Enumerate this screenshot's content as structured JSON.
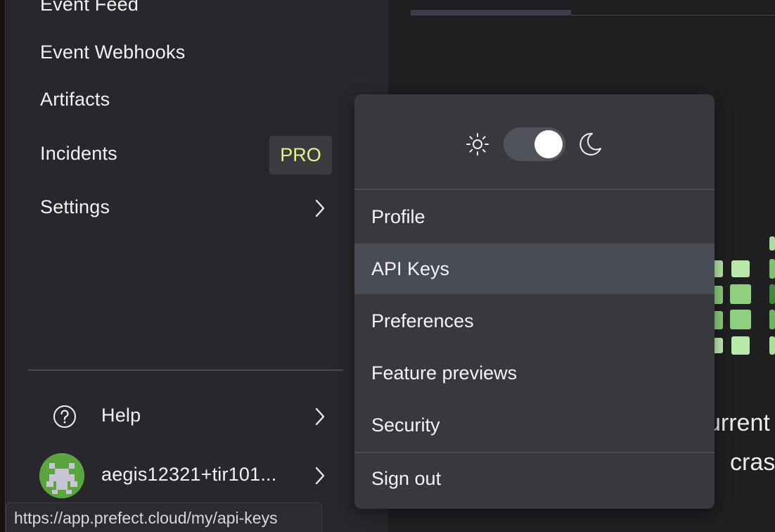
{
  "sidebar": {
    "items": [
      {
        "label": "Event Feed"
      },
      {
        "label": "Event Webhooks"
      },
      {
        "label": "Artifacts"
      },
      {
        "label": "Incidents",
        "badge": "PRO"
      },
      {
        "label": "Settings"
      }
    ],
    "help_label": "Help",
    "account_label": "aegis12321+tir101..."
  },
  "status_url": "https://app.prefect.cloud/my/api-keys",
  "user_menu": {
    "items": [
      "Profile",
      "API Keys",
      "Preferences",
      "Feature previews",
      "Security"
    ],
    "active_item": "API Keys",
    "sign_out": "Sign out",
    "theme_toggle": {
      "mode": "dark",
      "icons": [
        "sun-icon",
        "moon-icon"
      ]
    }
  },
  "background_text": {
    "line1": "urrent",
    "line2": "cras"
  },
  "colors": {
    "accent_pro": "#e6f28e",
    "grid_green": "#8fd07f",
    "menu_bg": "#38383e",
    "sidebar_bg": "#28282c"
  }
}
